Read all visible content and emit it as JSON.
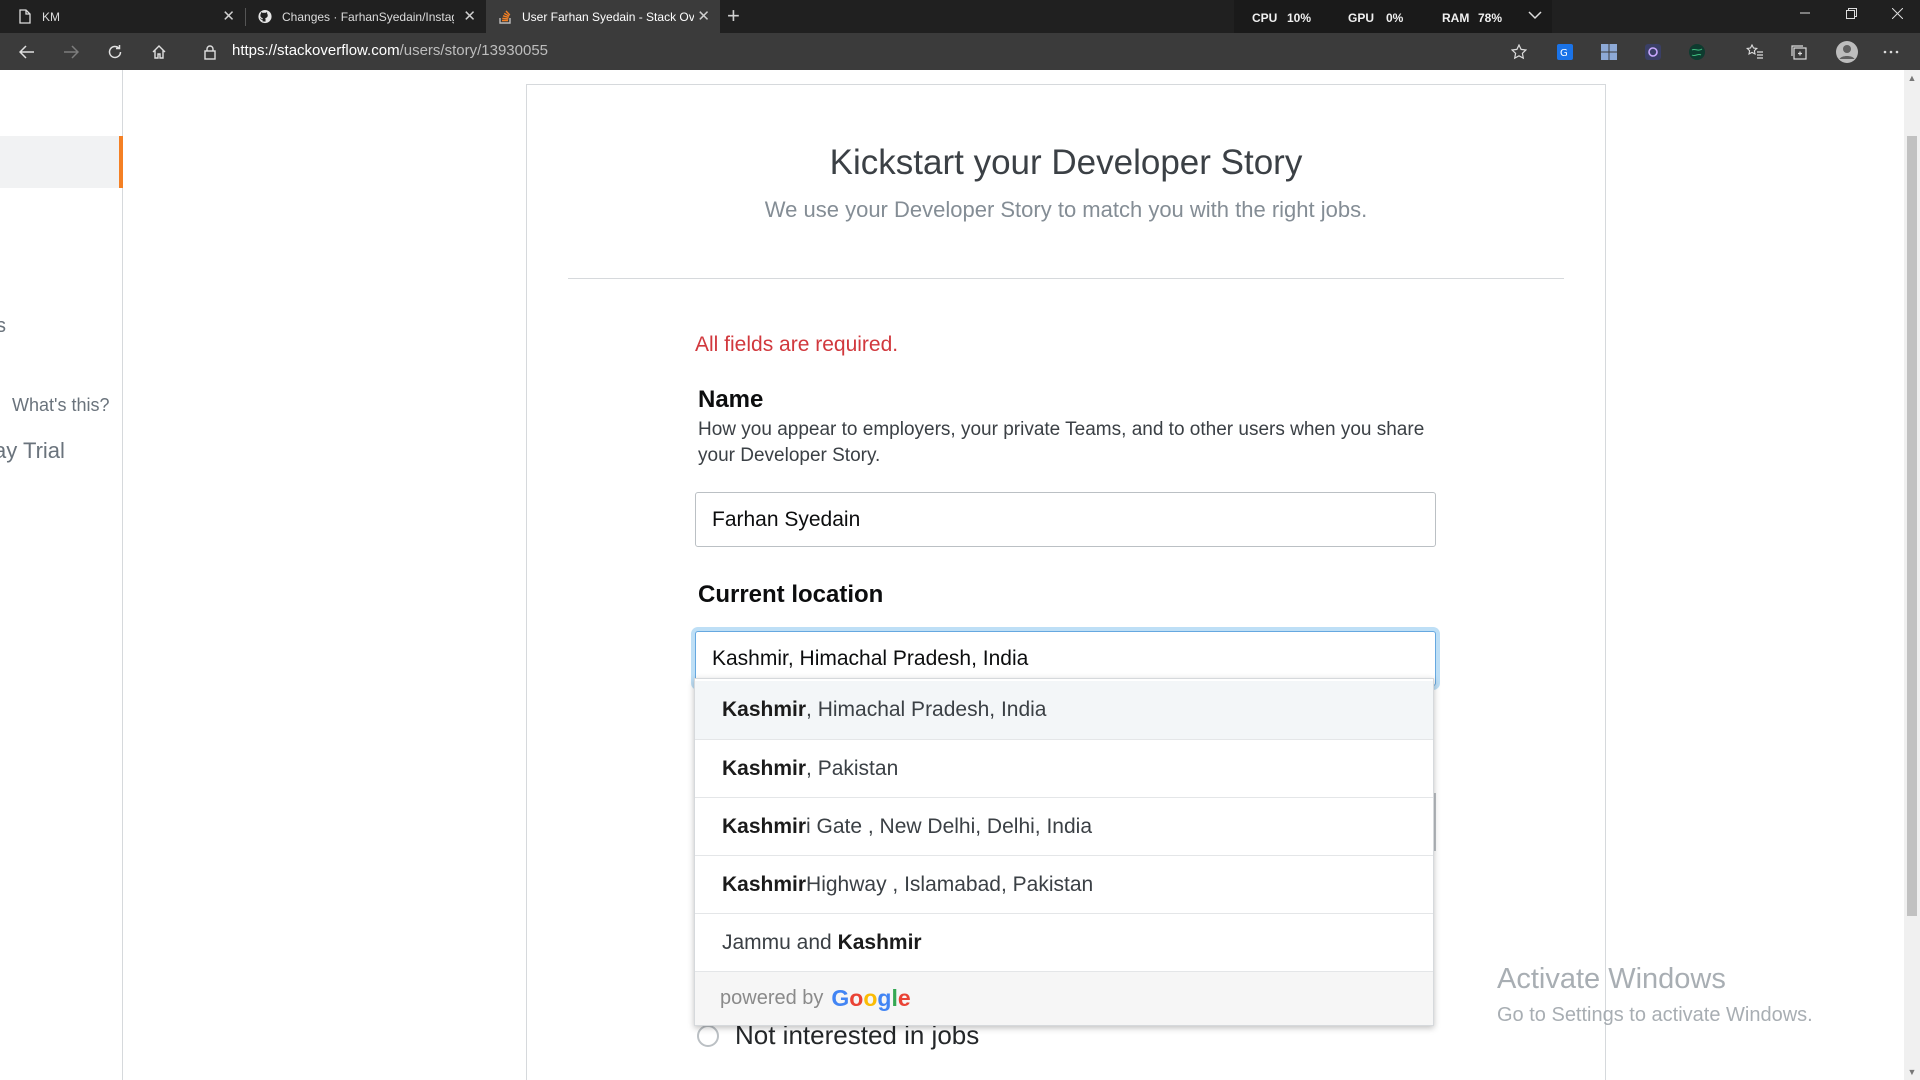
{
  "browser": {
    "tabs": [
      {
        "title": "KM",
        "icon": "document-icon"
      },
      {
        "title": "Changes · FarhanSyedain/Instagr",
        "icon": "github-icon"
      },
      {
        "title": "User Farhan Syedain - Stack Ove",
        "icon": "stackoverflow-icon"
      }
    ],
    "perf": {
      "cpu_label": "CPU",
      "cpu": "10%",
      "gpu_label": "GPU",
      "gpu": "0%",
      "ram_label": "RAM",
      "ram": "78%"
    },
    "url_host": "https://stackoverflow.com",
    "url_path": "/users/story/13930055"
  },
  "sidebar": {
    "partial_s": "s",
    "whats_this": "What's this?",
    "trial": "ay Trial"
  },
  "story": {
    "title": "Kickstart your Developer Story",
    "subtitle": "We use your Developer Story to match you with the right jobs.",
    "required": "All fields are required.",
    "name_label": "Name",
    "name_desc": "How you appear to employers, your private Teams, and to other users when you share your Developer Story.",
    "name_value": "Farhan Syedain",
    "location_label": "Current location",
    "location_value": "Kashmir, Himachal Pradesh, India",
    "radio_label": "Not interested in jobs"
  },
  "autocomplete": {
    "items": [
      {
        "bold": "Kashmir",
        "rest": " , Himachal Pradesh, India"
      },
      {
        "bold": "Kashmir",
        "rest": " , Pakistan"
      },
      {
        "bold": "Kashmir",
        "rest": "i Gate , New Delhi, Delhi, India"
      },
      {
        "bold": "Kashmir",
        "rest": " Highway , Islamabad, Pakistan"
      },
      {
        "prefix": "Jammu and ",
        "bold": "Kashmir"
      }
    ],
    "powered_by": "powered by",
    "google": "Google"
  },
  "watermark": {
    "line1": "Activate Windows",
    "line2": "Go to Settings to activate Windows."
  },
  "colors": {
    "accent": "#f48024",
    "error": "#d1383d",
    "focus": "#66a8e0"
  }
}
